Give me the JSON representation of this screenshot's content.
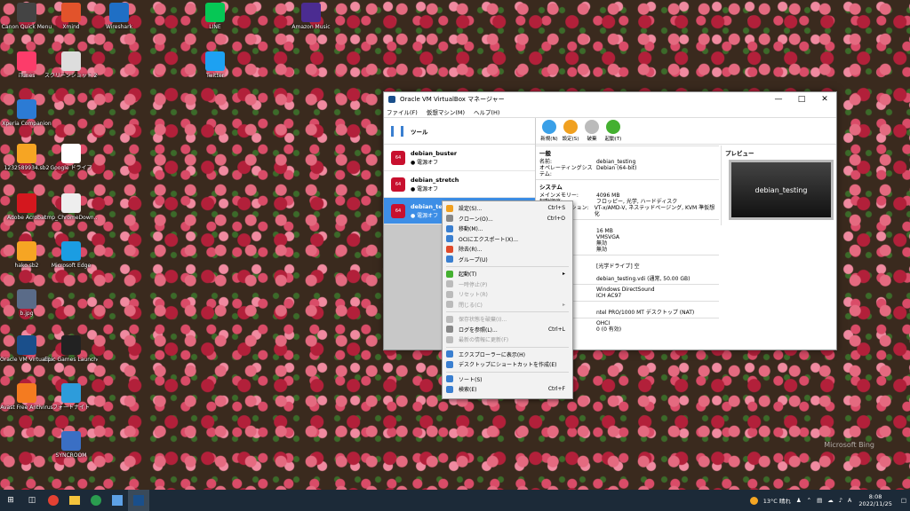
{
  "desktop_icons": [
    {
      "label": "Canon Quick Menu",
      "icon": "canon-icon",
      "color": "#444444"
    },
    {
      "label": "Xmind",
      "icon": "xmind-icon",
      "color": "#e2532b"
    },
    {
      "label": "Wireshark",
      "icon": "wireshark-icon",
      "color": "#1f6fc5"
    },
    {
      "label": "LINE",
      "icon": "line-icon",
      "color": "#06c755"
    },
    {
      "label": "Amazon Music",
      "icon": "amazon-music-icon",
      "color": "#4b2c91"
    },
    {
      "label": "iTunes",
      "icon": "itunes-icon",
      "color": "#fc3c6a"
    },
    {
      "label": "スクリーンショット 2021-10-10 1...",
      "icon": "screenshot-icon",
      "color": "#dddddd"
    },
    {
      "label": "Twitter",
      "icon": "twitter-icon",
      "color": "#1da1f2"
    },
    {
      "label": "Xperia Companion",
      "icon": "xperia-icon",
      "color": "#2c7bd4"
    },
    {
      "label": "1232589934.sb2",
      "icon": "scratch-file-icon",
      "color": "#f6a523"
    },
    {
      "label": "Google ドライブ",
      "icon": "google-drive-icon",
      "color": "#ffffff"
    },
    {
      "label": "Adobe Acrobat",
      "icon": "acrobat-icon",
      "color": "#d4171e"
    },
    {
      "label": "tmp_ChromeDown...",
      "icon": "folder-icon",
      "color": "#eeeeee"
    },
    {
      "label": "hako.sb2",
      "icon": "scratch-file-icon",
      "color": "#f6a523"
    },
    {
      "label": "Microsoft Edge",
      "icon": "edge-icon",
      "color": "#1b9de2"
    },
    {
      "label": "b.jpg",
      "icon": "image-file-icon",
      "color": "#5a6b88"
    },
    {
      "label": "Oracle VM VirtualBox",
      "icon": "virtualbox-icon",
      "color": "#1a4f8b"
    },
    {
      "label": "Epic Games Launcher",
      "icon": "epic-games-icon",
      "color": "#222222"
    },
    {
      "label": "Avast Free Antivirus",
      "icon": "avast-icon",
      "color": "#f47b20"
    },
    {
      "label": "フォートナイト",
      "icon": "fortnite-icon",
      "color": "#2d9cdb"
    },
    {
      "label": "SYNCROOM",
      "icon": "syncroom-icon",
      "color": "#3a6fc4"
    }
  ],
  "window": {
    "title": "Oracle VM VirtualBox マネージャー",
    "menu": [
      "ファイル(F)",
      "仮想マシン(M)",
      "ヘルプ(H)"
    ],
    "tools_label": "ツール",
    "vms": [
      {
        "name": "debian_buster",
        "state": "電源オフ"
      },
      {
        "name": "debian_stretch",
        "state": "電源オフ"
      },
      {
        "name": "debian_test",
        "state": "電源オフ"
      }
    ],
    "toolbar": [
      {
        "label": "新規(N)",
        "icon": "new-icon",
        "color": "#3aa0e8"
      },
      {
        "label": "設定(S)",
        "icon": "settings-icon",
        "color": "#f0a020"
      },
      {
        "label": "破棄",
        "icon": "discard-icon",
        "color": "#bbbbbb"
      },
      {
        "label": "起動(T)",
        "icon": "start-icon",
        "color": "#44b030"
      }
    ],
    "general": {
      "header": "一般",
      "rows": [
        {
          "k": "名前:",
          "v": "debian_testing"
        },
        {
          "k": "オペレーティングシステム:",
          "v": "Debian (64-bit)"
        }
      ]
    },
    "system": {
      "header": "システム",
      "rows": [
        {
          "k": "メインメモリー:",
          "v": "4096 MB"
        },
        {
          "k": "起動順序:",
          "v": "フロッピー, 光学, ハードディスク"
        },
        {
          "k": "アクセラレーション:",
          "v": "VT-x/AMD-V, ネステッドページング, KVM 準仮想化"
        }
      ]
    },
    "display_rows": [
      {
        "k": "イ",
        "v": ""
      },
      {
        "k": "",
        "v": "16 MB"
      },
      {
        "k": "トローラー:",
        "v": "VMSVGA"
      },
      {
        "k": "ーバー:",
        "v": "無効"
      },
      {
        "k": "",
        "v": "無効"
      }
    ],
    "storage_rows": [
      {
        "k": "DE",
        "v": ""
      },
      {
        "k": "マスター:",
        "v": "[光学ドライブ] 空"
      },
      {
        "k": "ATA",
        "v": ""
      },
      {
        "k": "0:",
        "v": "debian_testing.vdi (通常, 50.00 GB)"
      }
    ],
    "audio_rows": [
      {
        "k": "",
        "v": "Windows DirectSound"
      },
      {
        "k": "",
        "v": "ICH AC97"
      }
    ],
    "network_rows": [
      {
        "k": "ク",
        "v": ""
      },
      {
        "k": "",
        "v": "ntel PRO/1000 MT デスクトップ (NAT)"
      }
    ],
    "usb_rows": [
      {
        "k": "ラー:",
        "v": "OHCI"
      },
      {
        "k": "ー:",
        "v": "0 (0 有効)"
      }
    ],
    "preview_header": "プレビュー",
    "preview_text": "debian_testing"
  },
  "context_menu": {
    "groups": [
      [
        {
          "label": "設定(S)...",
          "shortcut": "Ctrl+S",
          "icon": "settings-icon",
          "color": "#f0a020",
          "disabled": false
        },
        {
          "label": "クローン(O)...",
          "shortcut": "Ctrl+O",
          "icon": "clone-icon",
          "color": "#888888",
          "disabled": false
        },
        {
          "label": "移動(M)...",
          "shortcut": "",
          "icon": "move-icon",
          "color": "#3a7fd0",
          "disabled": false
        },
        {
          "label": "OCIにエクスポート(X)...",
          "shortcut": "",
          "icon": "export-icon",
          "color": "#3a7fd0",
          "disabled": false
        },
        {
          "label": "除去(R)...",
          "shortcut": "",
          "icon": "remove-icon",
          "color": "#e04a2a",
          "disabled": false
        },
        {
          "label": "グループ(U)",
          "shortcut": "",
          "icon": "group-icon",
          "color": "#3a7fd0",
          "disabled": false
        }
      ],
      [
        {
          "label": "起動(T)",
          "shortcut": "",
          "icon": "start-icon",
          "color": "#44b030",
          "disabled": false,
          "submenu": true
        },
        {
          "label": "一時停止(P)",
          "shortcut": "",
          "icon": "pause-icon",
          "color": "#bbbbbb",
          "disabled": true
        },
        {
          "label": "リセット(R)",
          "shortcut": "",
          "icon": "reset-icon",
          "color": "#bbbbbb",
          "disabled": true
        },
        {
          "label": "閉じる(C)",
          "shortcut": "",
          "icon": "close-icon",
          "color": "#bbbbbb",
          "disabled": true,
          "submenu": true
        }
      ],
      [
        {
          "label": "保存状態を破棄(I)...",
          "shortcut": "",
          "icon": "discard-icon",
          "color": "#bbbbbb",
          "disabled": true
        },
        {
          "label": "ログを参照(L)...",
          "shortcut": "Ctrl+L",
          "icon": "log-icon",
          "color": "#888888",
          "disabled": false
        },
        {
          "label": "最新の情報に更新(F)",
          "shortcut": "",
          "icon": "refresh-icon",
          "color": "#bbbbbb",
          "disabled": true
        }
      ],
      [
        {
          "label": "エクスプローラーに表示(H)",
          "shortcut": "",
          "icon": "explorer-icon",
          "color": "#3a7fd0",
          "disabled": false
        },
        {
          "label": "デスクトップにショートカットを作成(E)",
          "shortcut": "",
          "icon": "shortcut-icon",
          "color": "#3a7fd0",
          "disabled": false
        }
      ],
      [
        {
          "label": "ソート(S)",
          "shortcut": "",
          "icon": "sort-icon",
          "color": "#3a7fd0",
          "disabled": false
        },
        {
          "label": "検索(E)",
          "shortcut": "Ctrl+F",
          "icon": "search-icon",
          "color": "#3a7fd0",
          "disabled": false
        }
      ]
    ]
  },
  "taskbar": {
    "weather": "13°C 晴れ",
    "ime": "A",
    "time": "8:08",
    "date": "2022/11/25"
  },
  "watermark": "Microsoft Bing"
}
